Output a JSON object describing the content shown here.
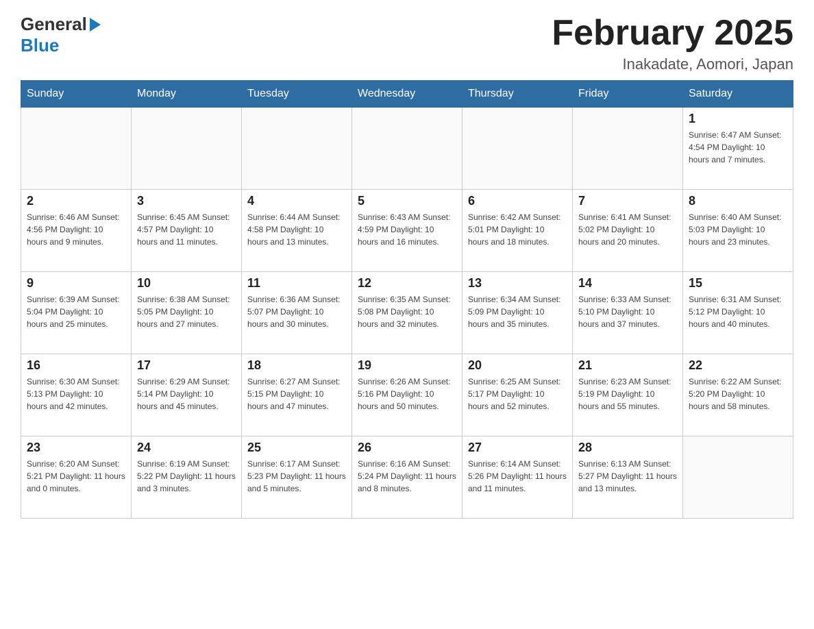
{
  "logo": {
    "general": "General",
    "blue": "Blue",
    "arrow": "▶"
  },
  "title": "February 2025",
  "location": "Inakadate, Aomori, Japan",
  "weekdays": [
    "Sunday",
    "Monday",
    "Tuesday",
    "Wednesday",
    "Thursday",
    "Friday",
    "Saturday"
  ],
  "weeks": [
    [
      {
        "day": "",
        "info": ""
      },
      {
        "day": "",
        "info": ""
      },
      {
        "day": "",
        "info": ""
      },
      {
        "day": "",
        "info": ""
      },
      {
        "day": "",
        "info": ""
      },
      {
        "day": "",
        "info": ""
      },
      {
        "day": "1",
        "info": "Sunrise: 6:47 AM\nSunset: 4:54 PM\nDaylight: 10 hours and 7 minutes."
      }
    ],
    [
      {
        "day": "2",
        "info": "Sunrise: 6:46 AM\nSunset: 4:56 PM\nDaylight: 10 hours and 9 minutes."
      },
      {
        "day": "3",
        "info": "Sunrise: 6:45 AM\nSunset: 4:57 PM\nDaylight: 10 hours and 11 minutes."
      },
      {
        "day": "4",
        "info": "Sunrise: 6:44 AM\nSunset: 4:58 PM\nDaylight: 10 hours and 13 minutes."
      },
      {
        "day": "5",
        "info": "Sunrise: 6:43 AM\nSunset: 4:59 PM\nDaylight: 10 hours and 16 minutes."
      },
      {
        "day": "6",
        "info": "Sunrise: 6:42 AM\nSunset: 5:01 PM\nDaylight: 10 hours and 18 minutes."
      },
      {
        "day": "7",
        "info": "Sunrise: 6:41 AM\nSunset: 5:02 PM\nDaylight: 10 hours and 20 minutes."
      },
      {
        "day": "8",
        "info": "Sunrise: 6:40 AM\nSunset: 5:03 PM\nDaylight: 10 hours and 23 minutes."
      }
    ],
    [
      {
        "day": "9",
        "info": "Sunrise: 6:39 AM\nSunset: 5:04 PM\nDaylight: 10 hours and 25 minutes."
      },
      {
        "day": "10",
        "info": "Sunrise: 6:38 AM\nSunset: 5:05 PM\nDaylight: 10 hours and 27 minutes."
      },
      {
        "day": "11",
        "info": "Sunrise: 6:36 AM\nSunset: 5:07 PM\nDaylight: 10 hours and 30 minutes."
      },
      {
        "day": "12",
        "info": "Sunrise: 6:35 AM\nSunset: 5:08 PM\nDaylight: 10 hours and 32 minutes."
      },
      {
        "day": "13",
        "info": "Sunrise: 6:34 AM\nSunset: 5:09 PM\nDaylight: 10 hours and 35 minutes."
      },
      {
        "day": "14",
        "info": "Sunrise: 6:33 AM\nSunset: 5:10 PM\nDaylight: 10 hours and 37 minutes."
      },
      {
        "day": "15",
        "info": "Sunrise: 6:31 AM\nSunset: 5:12 PM\nDaylight: 10 hours and 40 minutes."
      }
    ],
    [
      {
        "day": "16",
        "info": "Sunrise: 6:30 AM\nSunset: 5:13 PM\nDaylight: 10 hours and 42 minutes."
      },
      {
        "day": "17",
        "info": "Sunrise: 6:29 AM\nSunset: 5:14 PM\nDaylight: 10 hours and 45 minutes."
      },
      {
        "day": "18",
        "info": "Sunrise: 6:27 AM\nSunset: 5:15 PM\nDaylight: 10 hours and 47 minutes."
      },
      {
        "day": "19",
        "info": "Sunrise: 6:26 AM\nSunset: 5:16 PM\nDaylight: 10 hours and 50 minutes."
      },
      {
        "day": "20",
        "info": "Sunrise: 6:25 AM\nSunset: 5:17 PM\nDaylight: 10 hours and 52 minutes."
      },
      {
        "day": "21",
        "info": "Sunrise: 6:23 AM\nSunset: 5:19 PM\nDaylight: 10 hours and 55 minutes."
      },
      {
        "day": "22",
        "info": "Sunrise: 6:22 AM\nSunset: 5:20 PM\nDaylight: 10 hours and 58 minutes."
      }
    ],
    [
      {
        "day": "23",
        "info": "Sunrise: 6:20 AM\nSunset: 5:21 PM\nDaylight: 11 hours and 0 minutes."
      },
      {
        "day": "24",
        "info": "Sunrise: 6:19 AM\nSunset: 5:22 PM\nDaylight: 11 hours and 3 minutes."
      },
      {
        "day": "25",
        "info": "Sunrise: 6:17 AM\nSunset: 5:23 PM\nDaylight: 11 hours and 5 minutes."
      },
      {
        "day": "26",
        "info": "Sunrise: 6:16 AM\nSunset: 5:24 PM\nDaylight: 11 hours and 8 minutes."
      },
      {
        "day": "27",
        "info": "Sunrise: 6:14 AM\nSunset: 5:26 PM\nDaylight: 11 hours and 11 minutes."
      },
      {
        "day": "28",
        "info": "Sunrise: 6:13 AM\nSunset: 5:27 PM\nDaylight: 11 hours and 13 minutes."
      },
      {
        "day": "",
        "info": ""
      }
    ]
  ],
  "colors": {
    "header_bg": "#2e6da4",
    "header_text": "#ffffff",
    "border": "#cccccc"
  }
}
